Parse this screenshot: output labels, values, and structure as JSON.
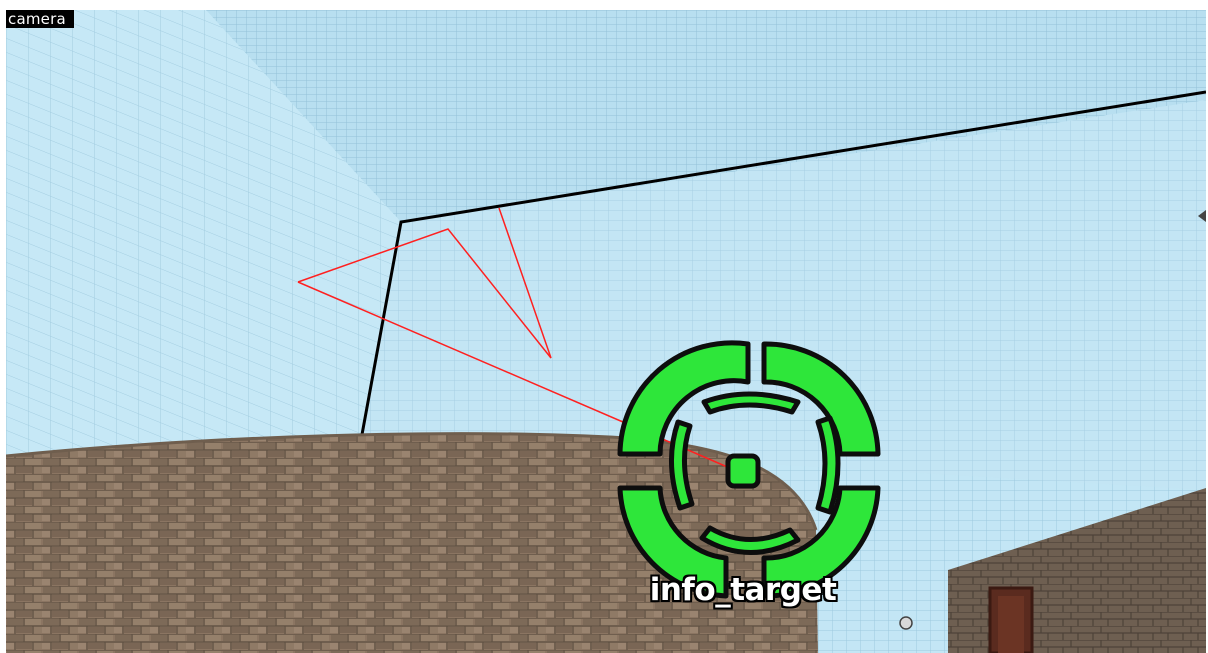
{
  "viewport": {
    "name": "camera",
    "entity_label": "info_target"
  },
  "colors": {
    "skybox": "#bfe3f2",
    "brick": "#8a7460",
    "wireframe_selected": "#ff2020",
    "brush_edge": "#000000",
    "entity_icon": "#2ee63a"
  },
  "icons": {
    "entity": "info-target-crosshair-icon",
    "light": "light-sprite-icon"
  }
}
